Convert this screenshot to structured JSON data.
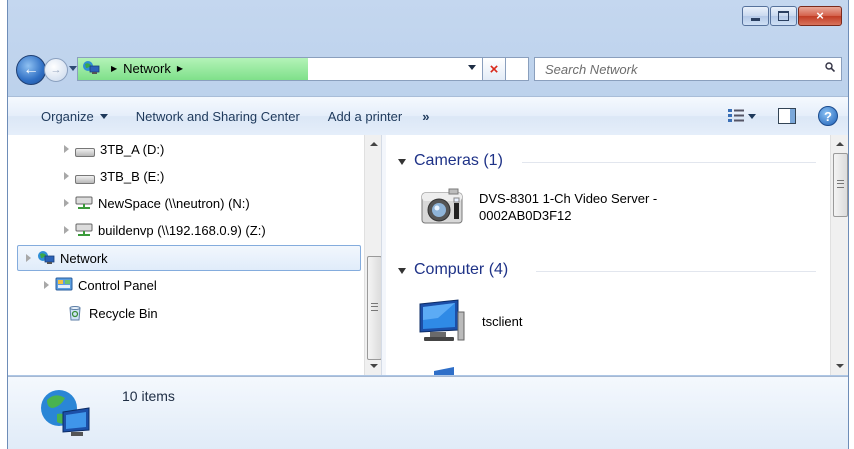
{
  "window": {
    "caption_buttons": {
      "minimize": "minimize",
      "maximize": "maximize",
      "close": "×"
    }
  },
  "nav": {
    "back_glyph": "←",
    "forward_glyph": "→"
  },
  "address": {
    "location": "Network",
    "progress_fraction": 0.51,
    "stop_glyph": "×"
  },
  "search": {
    "placeholder": "Search Network"
  },
  "toolbar": {
    "organize_label": "Organize",
    "network_sharing_label": "Network and Sharing Center",
    "add_printer_label": "Add a printer",
    "more_label": "»",
    "help_glyph": "?"
  },
  "tree": {
    "items": [
      {
        "label": "3TB_A (D:)",
        "icon": "drive-icon"
      },
      {
        "label": "3TB_B (E:)",
        "icon": "drive-icon"
      },
      {
        "label": "NewSpace (\\\\neutron) (N:)",
        "icon": "network-drive-icon"
      },
      {
        "label": "buildenvp (\\\\192.168.0.9) (Z:)",
        "icon": "network-drive-icon"
      },
      {
        "label": "Network",
        "icon": "network-icon",
        "selected": true
      },
      {
        "label": "Control Panel",
        "icon": "control-panel-icon"
      },
      {
        "label": "Recycle Bin",
        "icon": "recycle-bin-icon"
      }
    ]
  },
  "content": {
    "groups": [
      {
        "header": "Cameras (1)",
        "items": [
          {
            "label_line1": "DVS-8301 1-Ch Video Server -",
            "label_line2": "0002AB0D3F12",
            "icon": "camera-icon"
          }
        ]
      },
      {
        "header": "Computer (4)",
        "items": [
          {
            "label": "tsclient",
            "icon": "computer-icon"
          }
        ]
      }
    ]
  },
  "details": {
    "item_count": "10 items"
  },
  "colors": {
    "accent": "#1e3287",
    "close_button": "#c13c24",
    "progress_green": "#7fe08a",
    "selection_border": "#84acdd"
  }
}
